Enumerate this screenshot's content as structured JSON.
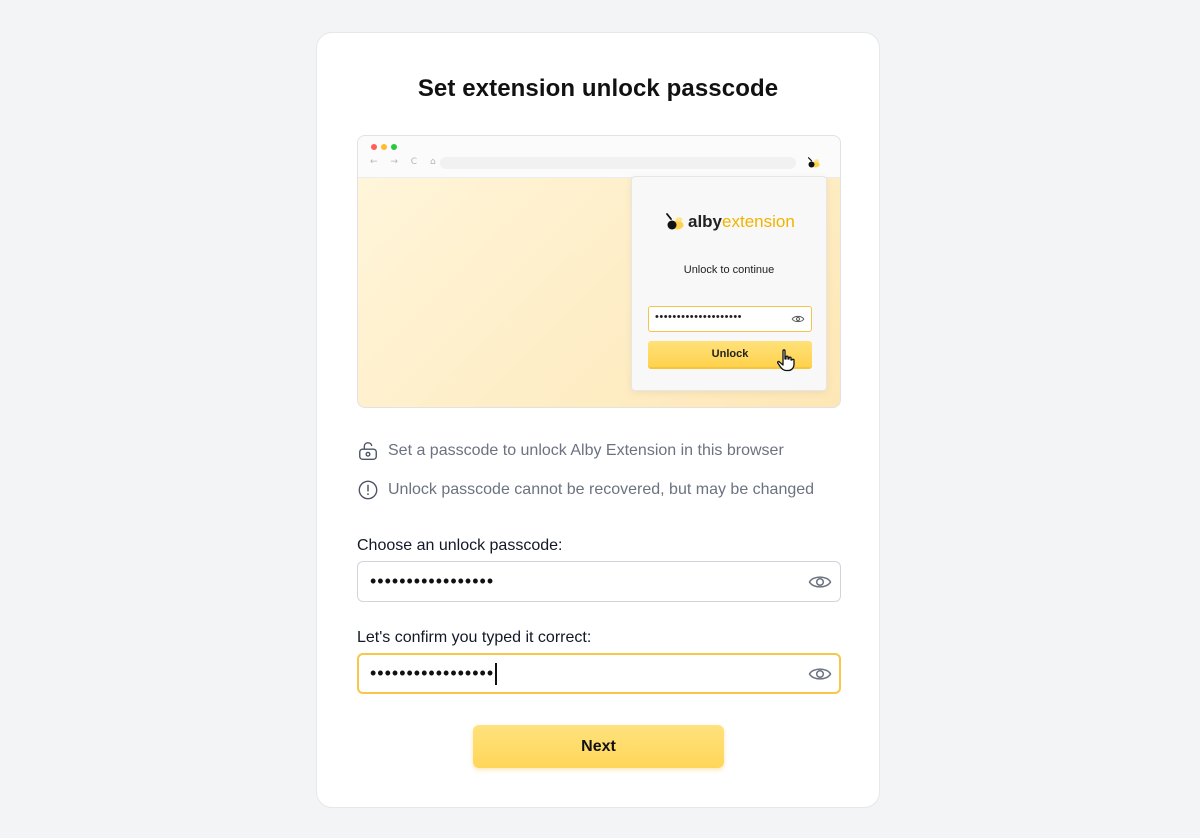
{
  "page": {
    "title": "Set extension unlock passcode"
  },
  "illustration": {
    "nav_glyphs": "← → C ⌂",
    "brand_alby": "alby",
    "brand_extension": "extension",
    "popup_text": "Unlock to continue",
    "popup_password_mask": "••••••••••••••••••••",
    "popup_button": "Unlock"
  },
  "info": [
    {
      "icon": "unlock-icon",
      "text": "Set a passcode to unlock Alby Extension in this browser"
    },
    {
      "icon": "alert-circle-icon",
      "text": "Unlock passcode cannot be recovered, but may be changed"
    }
  ],
  "form": {
    "passcode_label": "Choose an unlock passcode:",
    "passcode_value": "•••••••••••••••••",
    "confirm_label": "Let's confirm you typed it correct:",
    "confirm_value": "•••••••••••••••••",
    "next_label": "Next"
  },
  "colors": {
    "accent": "#ffd659",
    "focus_border": "#f8c74a",
    "background": "#f3f4f6"
  }
}
